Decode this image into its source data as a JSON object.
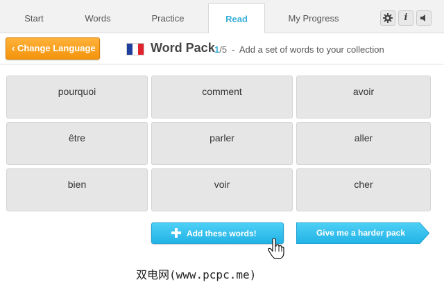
{
  "nav": {
    "tabs": [
      {
        "label": "Start"
      },
      {
        "label": "Words"
      },
      {
        "label": "Practice"
      },
      {
        "label": "Read",
        "active": true
      },
      {
        "label": "My Progress"
      }
    ],
    "icons": [
      "gear-icon",
      "info-icon",
      "sound-icon"
    ],
    "info_glyph": "i"
  },
  "subheader": {
    "change_language": "‹ Change Language",
    "flag": "france-flag",
    "title": "Word Pack",
    "current": "1",
    "total": "/5",
    "separator": "-",
    "description": "Add a set of words to your collection"
  },
  "words": [
    "pourquoi",
    "comment",
    "avoir",
    "être",
    "parler",
    "aller",
    "bien",
    "voir",
    "cher"
  ],
  "actions": {
    "add": "Add these words!",
    "harder": "Give me a harder pack"
  },
  "watermark": "双电网(www.pcpc.me)",
  "colors": {
    "accent_blue": "#3aaed8",
    "button_blue": "#2bbbea",
    "orange": "#f7a020",
    "tile_gray": "#e6e6e6"
  }
}
